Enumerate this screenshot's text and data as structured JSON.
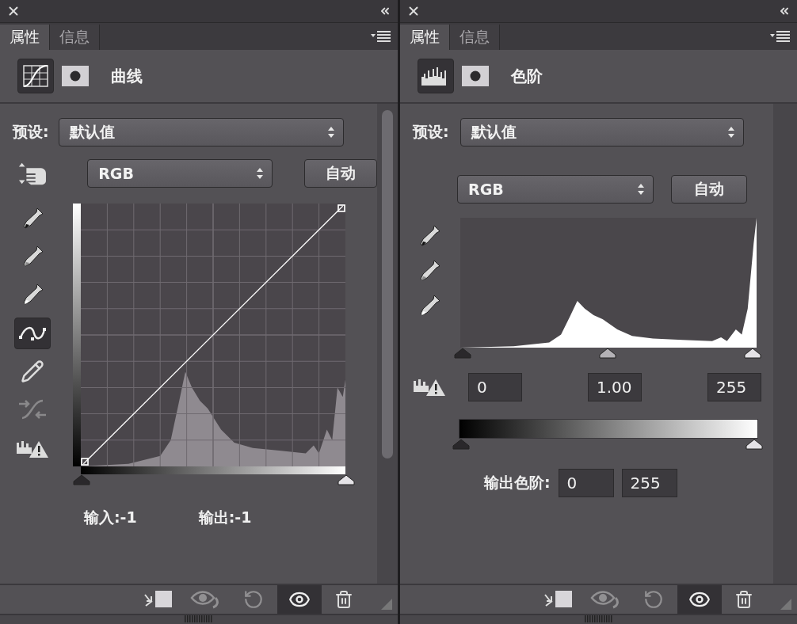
{
  "panels": [
    {
      "kind": "curves",
      "tabs": [
        {
          "label": "属性",
          "selected": true
        },
        {
          "label": "信息",
          "selected": false
        }
      ],
      "title": "曲线",
      "preset_label": "预设:",
      "preset": "默认值",
      "channel": "RGB",
      "auto_button": "自动",
      "tools": [
        {
          "kind": "eyedropper-black",
          "selected": false,
          "disabled": false
        },
        {
          "kind": "eyedropper-gray",
          "selected": false,
          "disabled": false
        },
        {
          "kind": "eyedropper-white",
          "selected": false,
          "disabled": false
        },
        {
          "kind": "points",
          "selected": true,
          "disabled": false
        },
        {
          "kind": "pencil",
          "selected": false,
          "disabled": false
        },
        {
          "kind": "smooth",
          "selected": false,
          "disabled": true
        },
        {
          "kind": "clipping",
          "selected": false,
          "disabled": false
        }
      ],
      "input_readout": "输入:-1",
      "output_readout": "输出:-1",
      "footer": [
        {
          "kind": "clip",
          "selected": false,
          "disabled": false
        },
        {
          "kind": "previous",
          "selected": false,
          "disabled": true
        },
        {
          "kind": "reset",
          "selected": false,
          "disabled": true
        },
        {
          "kind": "visibility",
          "selected": true,
          "disabled": false
        },
        {
          "kind": "delete",
          "selected": false,
          "disabled": false
        }
      ]
    },
    {
      "kind": "levels",
      "tabs": [
        {
          "label": "属性",
          "selected": true
        },
        {
          "label": "信息",
          "selected": false
        }
      ],
      "title": "色阶",
      "preset_label": "预设:",
      "preset": "默认值",
      "channel": "RGB",
      "auto_button": "自动",
      "tools": [
        {
          "kind": "eyedropper-black",
          "selected": false,
          "disabled": false
        },
        {
          "kind": "eyedropper-gray",
          "selected": false,
          "disabled": false
        },
        {
          "kind": "eyedropper-white",
          "selected": false,
          "disabled": false
        }
      ],
      "input_levels": [
        "0",
        "1.00",
        "255"
      ],
      "output_label": "输出色阶:",
      "output_levels": [
        "0",
        "255"
      ],
      "footer": [
        {
          "kind": "clip",
          "selected": false,
          "disabled": false
        },
        {
          "kind": "previous",
          "selected": false,
          "disabled": true
        },
        {
          "kind": "reset",
          "selected": false,
          "disabled": true
        },
        {
          "kind": "visibility",
          "selected": true,
          "disabled": false
        },
        {
          "kind": "delete",
          "selected": false,
          "disabled": false
        }
      ]
    }
  ]
}
